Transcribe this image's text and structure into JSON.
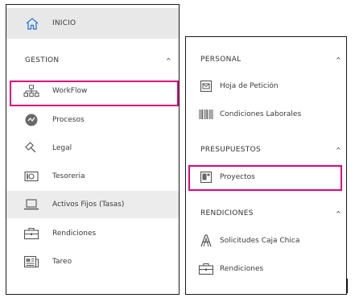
{
  "left_menu": {
    "home_label": "INICIO",
    "section_label": "GESTION",
    "section_chevron": "^",
    "items": [
      {
        "label": "WorkFlow",
        "icon": "org-chart-icon"
      },
      {
        "label": "Procesos",
        "icon": "process-icon"
      },
      {
        "label": "Legal",
        "icon": "gavel-icon"
      },
      {
        "label": "Tesoreria",
        "icon": "money-icon"
      },
      {
        "label": "Activos Fijos (Tasas)",
        "icon": "laptop-icon"
      },
      {
        "label": "Rendiciones",
        "icon": "briefcase-icon"
      },
      {
        "label": "Tareo",
        "icon": "newspaper-icon"
      }
    ]
  },
  "right_menu": {
    "sections": [
      {
        "label": "PERSONAL",
        "chevron": "^",
        "items": [
          {
            "label": "Hoja de Petición",
            "icon": "mail-icon"
          },
          {
            "label": "Condiciones Laborales",
            "icon": "barcode-icon"
          }
        ]
      },
      {
        "label": "PRESUPUESTOS",
        "chevron": "^",
        "items": [
          {
            "label": "Proyectos",
            "icon": "layout-icon"
          }
        ]
      },
      {
        "label": "RENDICIONES",
        "chevron": "^",
        "items": [
          {
            "label": "Solicitudes Caja Chica",
            "icon": "letter-a-icon"
          },
          {
            "label": "Rendiciones",
            "icon": "briefcase-icon"
          }
        ]
      }
    ]
  },
  "colors": {
    "highlight": "#e6007e",
    "home_icon": "#3b7dd8",
    "selected_bg": "#e8e8e8"
  }
}
